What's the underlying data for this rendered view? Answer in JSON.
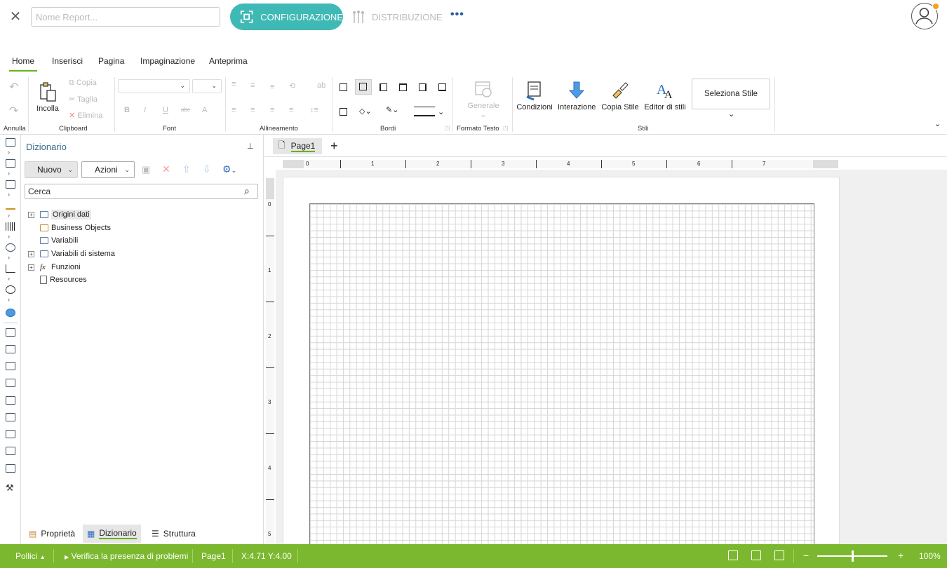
{
  "header": {
    "name_placeholder": "Nome Report...",
    "configurazione": "CONFIGURAZIONE",
    "distribuzione": "DISTRIBUZIONE",
    "more": "•••"
  },
  "menu_tabs": [
    "Home",
    "Inserisci",
    "Pagina",
    "Impaginazione",
    "Anteprima"
  ],
  "ribbon": {
    "annulla": "Annulla",
    "clipboard": {
      "label": "Clipboard",
      "incolla": "Incolla",
      "copia": "Copia",
      "taglia": "Taglia",
      "elimina": "Elimina"
    },
    "font": {
      "label": "Font",
      "bold": "B",
      "italic": "I",
      "underline": "U",
      "strike": "abc",
      "color": "A"
    },
    "allineamento": {
      "label": "Allineamento"
    },
    "bordi": {
      "label": "Bordi"
    },
    "formato_testo": {
      "label": "Formato Testo",
      "generale": "Generale"
    },
    "stili": {
      "label": "Stili",
      "condizioni": "Condizioni",
      "interazione": "Interazione",
      "copia_stile": "Copia Stile",
      "editor_stili": "Editor di stili",
      "seleziona_stile": "Seleziona Stile"
    }
  },
  "panel": {
    "title": "Dizionario",
    "nuovo": "Nuovo",
    "azioni": "Azioni",
    "search_placeholder": "Cerca",
    "tree": [
      "Origini dati",
      "Business Objects",
      "Variabili",
      "Variabili di sistema",
      "Funzioni",
      "Resources"
    ],
    "bottom_tabs": {
      "proprieta": "Proprietà",
      "dizionario": "Dizionario",
      "struttura": "Struttura"
    }
  },
  "document": {
    "page_tab": "Page1",
    "add_tab": "+",
    "h_ruler": [
      "0",
      "1",
      "2",
      "3",
      "4",
      "5",
      "6",
      "7"
    ],
    "v_ruler": [
      "0",
      "1",
      "2",
      "3",
      "4",
      "5"
    ]
  },
  "status": {
    "units": "Pollici",
    "check": "Verifica la presenza di problemi",
    "page": "Page1",
    "coords": "X:4.71 Y:4.00",
    "zoom": "100%",
    "zoom_fraction": 0.5,
    "minus": "−",
    "plus": "+"
  },
  "colors": {
    "accent": "#3fb9b5",
    "status_bar": "#7cb82f",
    "tab_underline": "#67b21c"
  }
}
